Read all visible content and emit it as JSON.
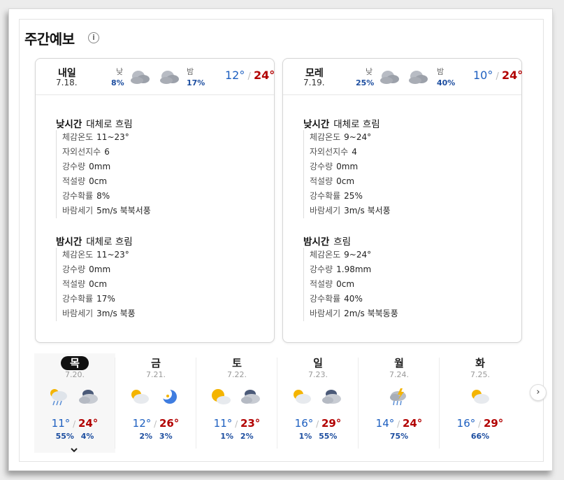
{
  "header": {
    "title": "주간예보",
    "info_icon": "i"
  },
  "cards": [
    {
      "day": "내일",
      "date": "7.18.",
      "am_label": "낮",
      "am_prob": "8%",
      "pm_label": "밤",
      "pm_prob": "17%",
      "low": "12°",
      "high": "24°",
      "day_section": {
        "label": "낮시간",
        "condition": "대체로 흐림",
        "rows": [
          {
            "k": "체감온도",
            "v": "11~23°"
          },
          {
            "k": "자외선지수",
            "v": "6"
          },
          {
            "k": "강수량",
            "v": "0mm"
          },
          {
            "k": "적설량",
            "v": "0cm"
          },
          {
            "k": "강수확률",
            "v": "8%"
          },
          {
            "k": "바람세기",
            "v": "5m/s 북북서풍"
          }
        ]
      },
      "night_section": {
        "label": "밤시간",
        "condition": "대체로 흐림",
        "rows": [
          {
            "k": "체감온도",
            "v": "11~23°"
          },
          {
            "k": "강수량",
            "v": "0mm"
          },
          {
            "k": "적설량",
            "v": "0cm"
          },
          {
            "k": "강수확률",
            "v": "17%"
          },
          {
            "k": "바람세기",
            "v": "3m/s 북풍"
          }
        ]
      }
    },
    {
      "day": "모레",
      "date": "7.19.",
      "am_label": "낮",
      "am_prob": "25%",
      "pm_label": "밤",
      "pm_prob": "40%",
      "low": "10°",
      "high": "24°",
      "day_section": {
        "label": "낮시간",
        "condition": "대체로 흐림",
        "rows": [
          {
            "k": "체감온도",
            "v": "9~24°"
          },
          {
            "k": "자외선지수",
            "v": "4"
          },
          {
            "k": "강수량",
            "v": "0mm"
          },
          {
            "k": "적설량",
            "v": "0cm"
          },
          {
            "k": "강수확률",
            "v": "25%"
          },
          {
            "k": "바람세기",
            "v": "3m/s 북서풍"
          }
        ]
      },
      "night_section": {
        "label": "밤시간",
        "condition": "흐림",
        "rows": [
          {
            "k": "체감온도",
            "v": "9~24°"
          },
          {
            "k": "강수량",
            "v": "1.98mm"
          },
          {
            "k": "적설량",
            "v": "0cm"
          },
          {
            "k": "강수확률",
            "v": "40%"
          },
          {
            "k": "바람세기",
            "v": "2m/s 북북동풍"
          }
        ]
      }
    }
  ],
  "strip": [
    {
      "wd": "목",
      "date": "7.20.",
      "low": "11°",
      "high": "24°",
      "am": "55%",
      "pm": "4%",
      "icons": [
        "rain-icon",
        "cloudy-night-icon"
      ]
    },
    {
      "wd": "금",
      "date": "7.21.",
      "low": "12°",
      "high": "26°",
      "am": "2%",
      "pm": "3%",
      "icons": [
        "partly-cloudy-icon",
        "moon-icon"
      ]
    },
    {
      "wd": "토",
      "date": "7.22.",
      "low": "11°",
      "high": "23°",
      "am": "1%",
      "pm": "2%",
      "icons": [
        "partly-cloudy-icon",
        "cloudy-night-icon"
      ]
    },
    {
      "wd": "일",
      "date": "7.23.",
      "low": "16°",
      "high": "29°",
      "am": "1%",
      "pm": "55%",
      "icons": [
        "partly-cloudy-icon",
        "cloudy-night-icon"
      ]
    },
    {
      "wd": "월",
      "date": "7.24.",
      "low": "14°",
      "high": "24°",
      "am": "75%",
      "pm": "",
      "icons": [
        "thunderstorm-icon"
      ]
    },
    {
      "wd": "화",
      "date": "7.25.",
      "low": "16°",
      "high": "29°",
      "am": "66%",
      "pm": "",
      "icons": [
        "partly-cloudy-icon"
      ]
    }
  ],
  "next_icon": "›"
}
